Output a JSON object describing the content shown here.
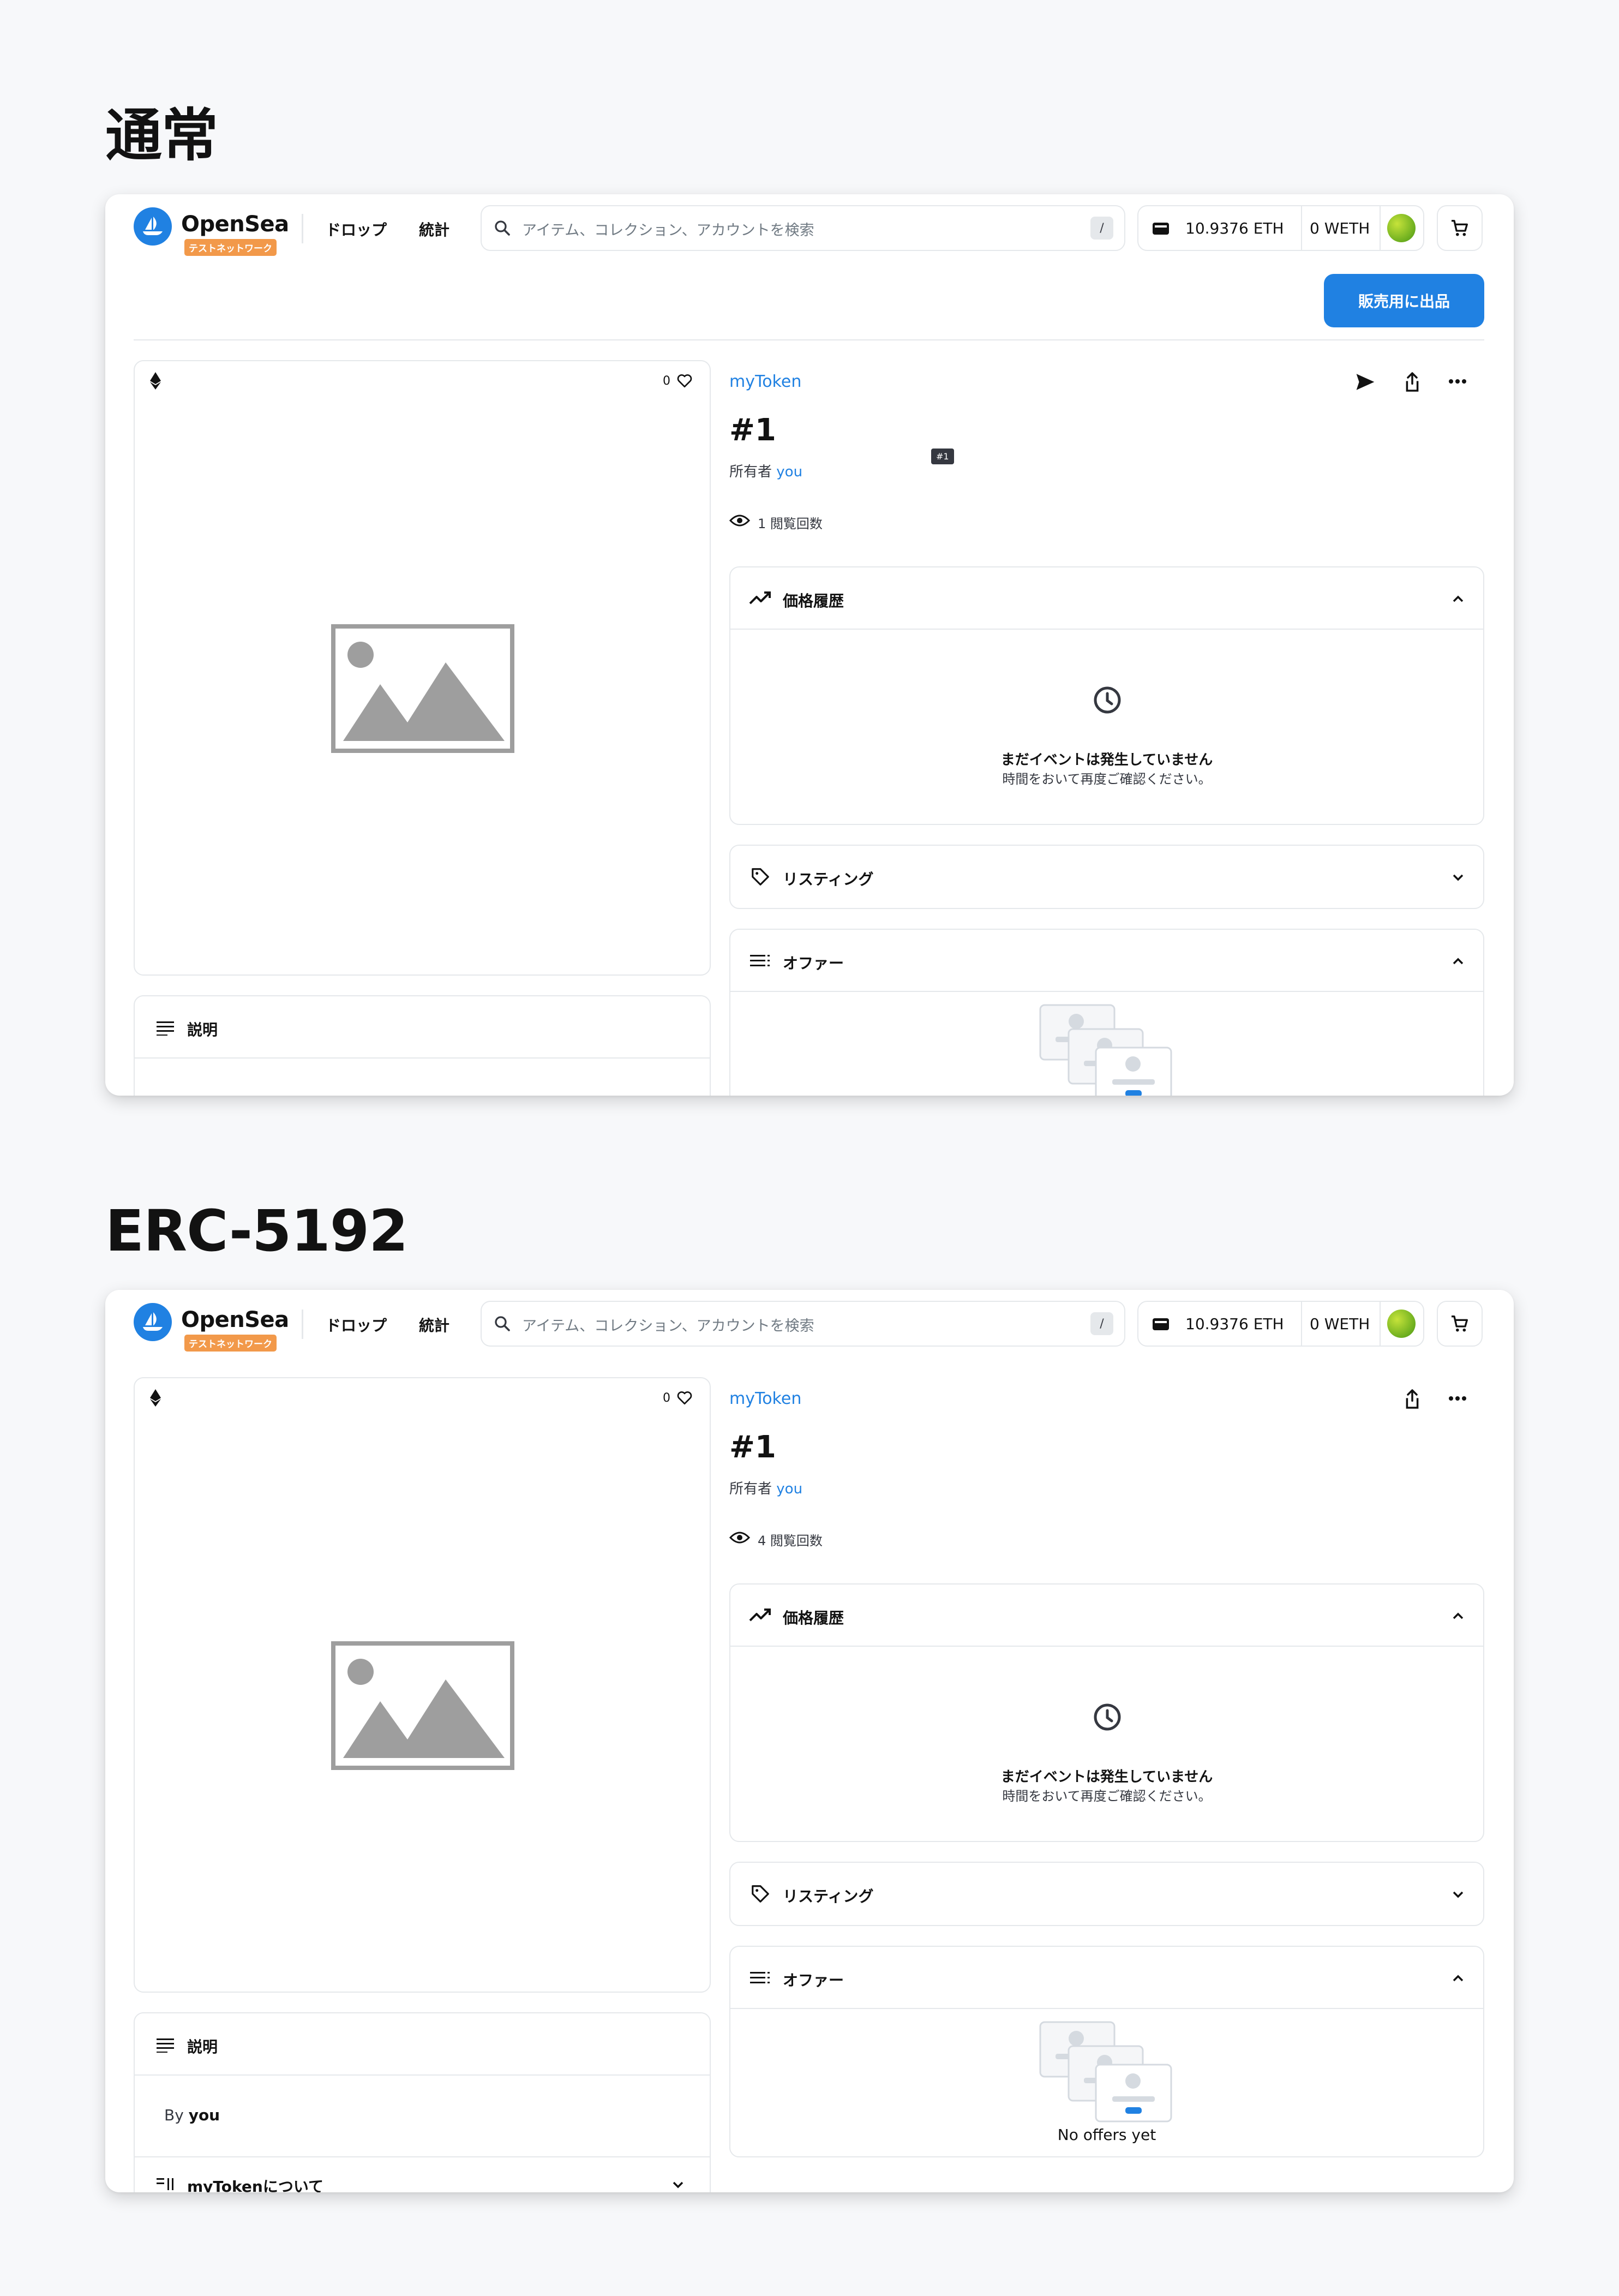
{
  "sections": [
    {
      "heading": "通常",
      "nav": {
        "logo": "OpenSea",
        "testnet_badge": "テストネットワーク",
        "drops": "ドロップ",
        "stats": "統計",
        "search_placeholder": "アイテム、コレクション、アカウントを検索",
        "search_shortcut": "/",
        "eth_balance": "10.9376 ETH",
        "weth_balance": "0 WETH"
      },
      "sell_button": "販売用に出品",
      "likes": "0",
      "collection": "myToken",
      "token_id": "#1",
      "owner_prefix": "所有者",
      "owner_name": "you",
      "tooltip": "#1",
      "views": "1 閲覧回数",
      "price_history": {
        "title": "価格履歴",
        "empty_title": "まだイベントは発生していません",
        "empty_sub": "時間をおいて再度ご確認ください。"
      },
      "listings": "リスティング",
      "offers": "オファー",
      "description": "説明"
    },
    {
      "heading": "ERC-5192",
      "nav": {
        "logo": "OpenSea",
        "testnet_badge": "テストネットワーク",
        "drops": "ドロップ",
        "stats": "統計",
        "search_placeholder": "アイテム、コレクション、アカウントを検索",
        "search_shortcut": "/",
        "eth_balance": "10.9376 ETH",
        "weth_balance": "0 WETH"
      },
      "likes": "0",
      "collection": "myToken",
      "token_id": "#1",
      "owner_prefix": "所有者",
      "owner_name": "you",
      "views": "4 閲覧回数",
      "price_history": {
        "title": "価格履歴",
        "empty_title": "まだイベントは発生していません",
        "empty_sub": "時間をおいて再度ご確認ください。"
      },
      "listings": "リスティング",
      "offers": "オファー",
      "no_offers": "No offers yet",
      "description": "説明",
      "by_prefix": "By",
      "by_name": "you",
      "about": "myTokenについて"
    }
  ],
  "colors": {
    "accent": "#2081e2",
    "testnet": "#f2994a",
    "border": "#e5e8eb",
    "background": "#f7f8fa"
  }
}
